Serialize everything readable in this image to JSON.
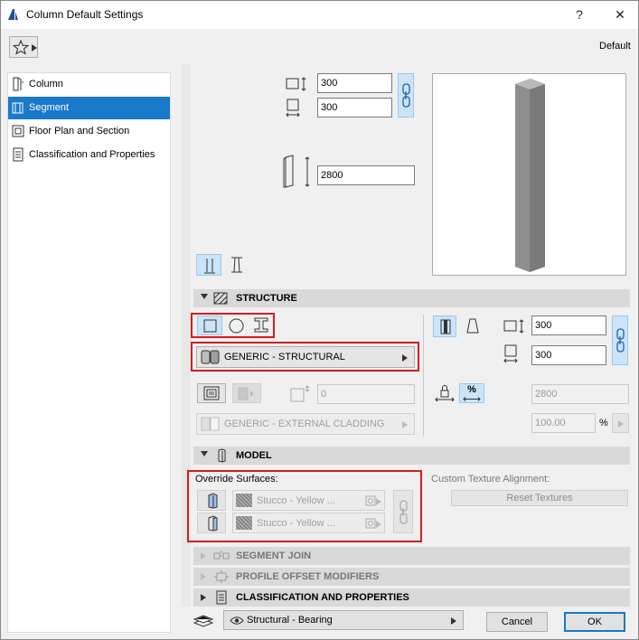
{
  "window": {
    "title": "Column Default Settings",
    "help": "?",
    "close": "✕",
    "preset": "Default"
  },
  "sidebar": {
    "items": [
      {
        "label": "Column"
      },
      {
        "label": "Segment"
      },
      {
        "label": "Floor Plan and Section"
      },
      {
        "label": "Classification and Properties"
      }
    ]
  },
  "dimensions": {
    "width": "300",
    "depth": "300",
    "height": "2800"
  },
  "structure": {
    "header": "STRUCTURE",
    "material": "GENERIC - STRUCTURAL",
    "core_value": "0",
    "cladding": "GENERIC - EXTERNAL CLADDING",
    "width": "300",
    "depth": "300",
    "height": "2800",
    "percent": "100.00",
    "percent_unit": "%",
    "pct_toggle": "%"
  },
  "model": {
    "header": "MODEL",
    "override_label": "Override Surfaces:",
    "surface1": "Stucco - Yellow ...",
    "surface2": "Stucco - Yellow ...",
    "texture_label": "Custom Texture Alignment:",
    "reset_label": "Reset Textures"
  },
  "sections": {
    "segment_join": "SEGMENT JOIN",
    "profile_offset": "PROFILE OFFSET MODIFIERS",
    "classification": "CLASSIFICATION AND PROPERTIES"
  },
  "footer": {
    "layer": "Structural - Bearing",
    "cancel": "Cancel",
    "ok": "OK"
  },
  "colors": {
    "accent": "#1979ca",
    "highlight": "#d21e1e"
  }
}
